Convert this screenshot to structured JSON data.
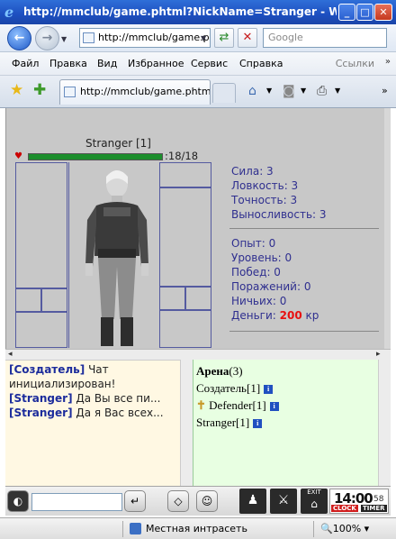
{
  "window": {
    "title": "http://mmclub/game.phtml?NickName=Stranger - Windows I..."
  },
  "address": {
    "url": "http://mmclub/game.p",
    "search_placeholder": "Google"
  },
  "menu": {
    "items": [
      "Файл",
      "Правка",
      "Вид",
      "Избранное",
      "Сервис",
      "Справка"
    ],
    "links_label": "Ссылки"
  },
  "tab": {
    "title": "http://mmclub/game.phtml..."
  },
  "character": {
    "name": "Stranger [1]",
    "hp_text": ":18/18",
    "hp_fraction": 1.0
  },
  "stats": {
    "strength": "Сила: 3",
    "agility": "Ловкость: 3",
    "accuracy": "Точность: 3",
    "endurance": "Выносливость: 3",
    "experience": "Опыт: 0",
    "level": "Уровень: 0",
    "wins": "Побед: 0",
    "losses": "Поражений: 0",
    "draws": "Ничьих: 0",
    "money_label": "Деньги:",
    "money_value": "200",
    "money_unit": "кр"
  },
  "chat": {
    "messages": [
      {
        "who": "[Создатель]",
        "text": " Чат инициализирован!"
      },
      {
        "who": "[Stranger]",
        "text": " Да Вы все пи..."
      },
      {
        "who": "[Stranger]",
        "text": " Да я Вас всех..."
      }
    ]
  },
  "arena": {
    "title": "Арена",
    "count": "(3)",
    "players": [
      "Создатель[1]",
      "Defender[1]",
      "Stranger[1]"
    ]
  },
  "clock": {
    "time": "14:00",
    "seconds": "58",
    "clock_label": "CLOCK",
    "timer_label": "TIMER"
  },
  "bottom": {
    "exit_label": "EXIT"
  },
  "status": {
    "zone": "Местная интрасеть",
    "zoom": "100%"
  }
}
